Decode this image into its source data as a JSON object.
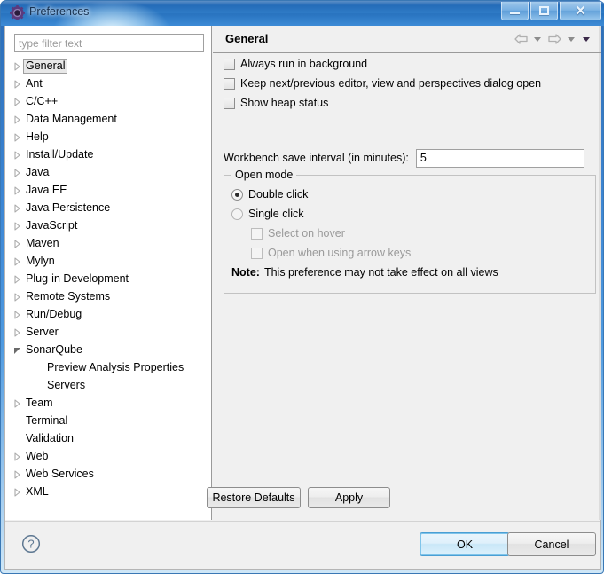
{
  "window": {
    "title": "Preferences",
    "icon": "gear-icon",
    "controls": {
      "minimize": "minimize-icon",
      "maximize": "maximize-icon",
      "close": "close-icon"
    }
  },
  "sidebar": {
    "filter": {
      "placeholder": "type filter text",
      "value": ""
    },
    "items": [
      {
        "label": "General",
        "indent": 0,
        "arrow": "collapsed",
        "selected": true
      },
      {
        "label": "Ant",
        "indent": 0,
        "arrow": "collapsed",
        "selected": false
      },
      {
        "label": "C/C++",
        "indent": 0,
        "arrow": "collapsed",
        "selected": false
      },
      {
        "label": "Data Management",
        "indent": 0,
        "arrow": "collapsed",
        "selected": false
      },
      {
        "label": "Help",
        "indent": 0,
        "arrow": "collapsed",
        "selected": false
      },
      {
        "label": "Install/Update",
        "indent": 0,
        "arrow": "collapsed",
        "selected": false
      },
      {
        "label": "Java",
        "indent": 0,
        "arrow": "collapsed",
        "selected": false
      },
      {
        "label": "Java EE",
        "indent": 0,
        "arrow": "collapsed",
        "selected": false
      },
      {
        "label": "Java Persistence",
        "indent": 0,
        "arrow": "collapsed",
        "selected": false
      },
      {
        "label": "JavaScript",
        "indent": 0,
        "arrow": "collapsed",
        "selected": false
      },
      {
        "label": "Maven",
        "indent": 0,
        "arrow": "collapsed",
        "selected": false
      },
      {
        "label": "Mylyn",
        "indent": 0,
        "arrow": "collapsed",
        "selected": false
      },
      {
        "label": "Plug-in Development",
        "indent": 0,
        "arrow": "collapsed",
        "selected": false
      },
      {
        "label": "Remote Systems",
        "indent": 0,
        "arrow": "collapsed",
        "selected": false
      },
      {
        "label": "Run/Debug",
        "indent": 0,
        "arrow": "collapsed",
        "selected": false
      },
      {
        "label": "Server",
        "indent": 0,
        "arrow": "collapsed",
        "selected": false
      },
      {
        "label": "SonarQube",
        "indent": 0,
        "arrow": "expanded",
        "selected": false
      },
      {
        "label": "Preview Analysis Properties",
        "indent": 1,
        "arrow": "none",
        "selected": false
      },
      {
        "label": "Servers",
        "indent": 1,
        "arrow": "none",
        "selected": false
      },
      {
        "label": "Team",
        "indent": 0,
        "arrow": "collapsed",
        "selected": false
      },
      {
        "label": "Terminal",
        "indent": 0,
        "arrow": "none",
        "selected": false
      },
      {
        "label": "Validation",
        "indent": 0,
        "arrow": "none",
        "selected": false
      },
      {
        "label": "Web",
        "indent": 0,
        "arrow": "collapsed",
        "selected": false
      },
      {
        "label": "Web Services",
        "indent": 0,
        "arrow": "collapsed",
        "selected": false
      },
      {
        "label": "XML",
        "indent": 0,
        "arrow": "collapsed",
        "selected": false
      }
    ]
  },
  "page": {
    "title": "General",
    "nav": {
      "back": "back-arrow-icon",
      "back_menu": "chevron-down-icon",
      "forward": "forward-arrow-icon",
      "forward_menu": "chevron-down-icon",
      "page_menu": "chevron-down-icon"
    },
    "checkboxes": [
      {
        "label": "Always run in background",
        "checked": false,
        "enabled": true
      },
      {
        "label": "Keep next/previous editor, view and perspectives dialog open",
        "checked": false,
        "enabled": true
      },
      {
        "label": "Show heap status",
        "checked": false,
        "enabled": true
      }
    ],
    "save_interval": {
      "label": "Workbench save interval (in minutes):",
      "value": "5",
      "placeholder": ""
    },
    "open_mode": {
      "title": "Open mode",
      "radios": [
        {
          "label": "Double click",
          "selected": true
        },
        {
          "label": "Single click",
          "selected": false
        }
      ],
      "sub_checkboxes": [
        {
          "label": "Select on hover",
          "checked": false,
          "enabled": false
        },
        {
          "label": "Open when using arrow keys",
          "checked": false,
          "enabled": false
        }
      ],
      "note_prefix": "Note:",
      "note_text": "This preference may not take effect on all views"
    },
    "restore_defaults_label": "Restore Defaults",
    "apply_label": "Apply"
  },
  "footer": {
    "help_icon": "help-icon",
    "ok_label": "OK",
    "cancel_label": "Cancel"
  },
  "colors": {
    "title_blue": "#2f7bc6",
    "panel_bg": "#f0f0f0",
    "tree_bg": "#ffffff",
    "default_button_border": "#4a9fd4",
    "disabled_text": "#9a9a9a"
  }
}
